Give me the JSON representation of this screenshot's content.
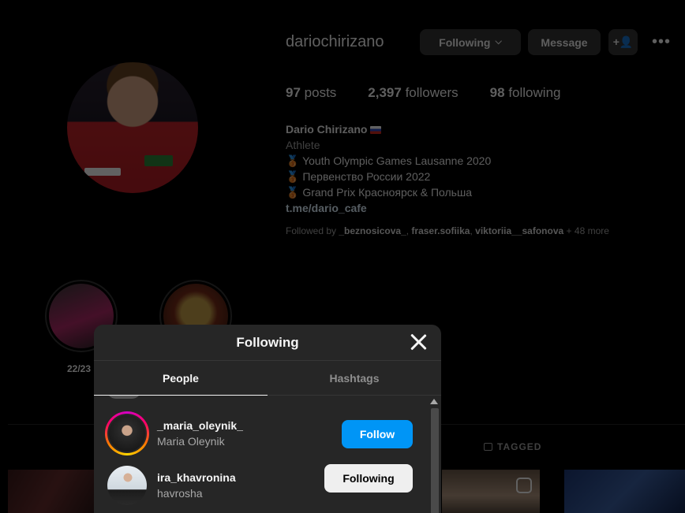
{
  "profile": {
    "username": "dariochirizano",
    "following_button": "Following",
    "message_button": "Message",
    "add_user_button": "+👤",
    "more_button": "•••",
    "stats": {
      "posts_count": "97",
      "posts_label": "posts",
      "followers_count": "2,397",
      "followers_label": "followers",
      "following_count": "98",
      "following_label": "following"
    },
    "bio": {
      "name": "Dario Chirizano",
      "category": "Athlete",
      "line1": "🥉 Youth Olympic Games Lausanne 2020",
      "line2": "🥉 Первенство России 2022",
      "line3": "🥉 Grand Prix Красноярск & Польша",
      "link": "t.me/dario_cafe"
    },
    "followed_by": {
      "prefix": "Followed by",
      "user1": "_beznosicova_",
      "user2": "fraser.sofiika",
      "user3": "viktoriia__safonova",
      "more": "+ 48 more"
    },
    "highlight_label": "22/23",
    "tagged_tab": "TAGGED"
  },
  "modal": {
    "title": "Following",
    "tabs": [
      {
        "label": "People"
      },
      {
        "label": "Hashtags"
      }
    ],
    "rows": [
      {
        "username": "_maria_oleynik_",
        "name": "Maria Oleynik",
        "button": "Follow"
      },
      {
        "username": "ira_khavronina",
        "name": "havrosha",
        "button": "Following"
      }
    ]
  },
  "colors": {
    "background": "#000000",
    "modal_bg": "#262626",
    "accent_blue": "#0095f6"
  }
}
